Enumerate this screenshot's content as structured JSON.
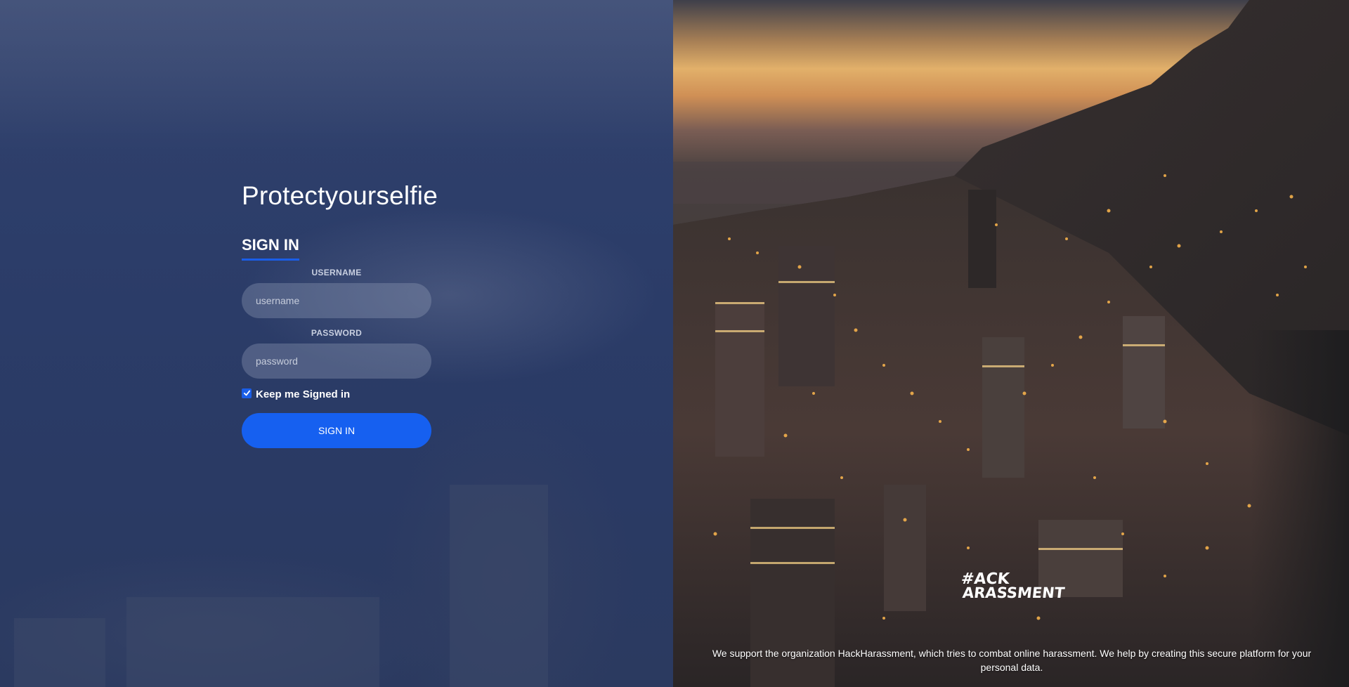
{
  "brand": {
    "title": "Protectyourselfie"
  },
  "signin_form": {
    "heading": "SIGN IN",
    "username_label": "USERNAME",
    "username_placeholder": "username",
    "username_value": "",
    "password_label": "PASSWORD",
    "password_placeholder": "password",
    "password_value": "",
    "keep_signed_in_label": "Keep me Signed in",
    "keep_signed_in_checked": true,
    "submit_label": "SIGN IN"
  },
  "partner": {
    "logo_text_line1": "#ACK",
    "logo_text_line2": "ARASSMENT",
    "footer_text": "We support the organization HackHarassment, which tries to combat online harassment. We help by creating this secure platform for your personal data."
  },
  "colors": {
    "accent": "#1660f0",
    "left_panel_bg": "#2b3c68"
  },
  "icons": {
    "checkbox": "checkmark-icon"
  }
}
